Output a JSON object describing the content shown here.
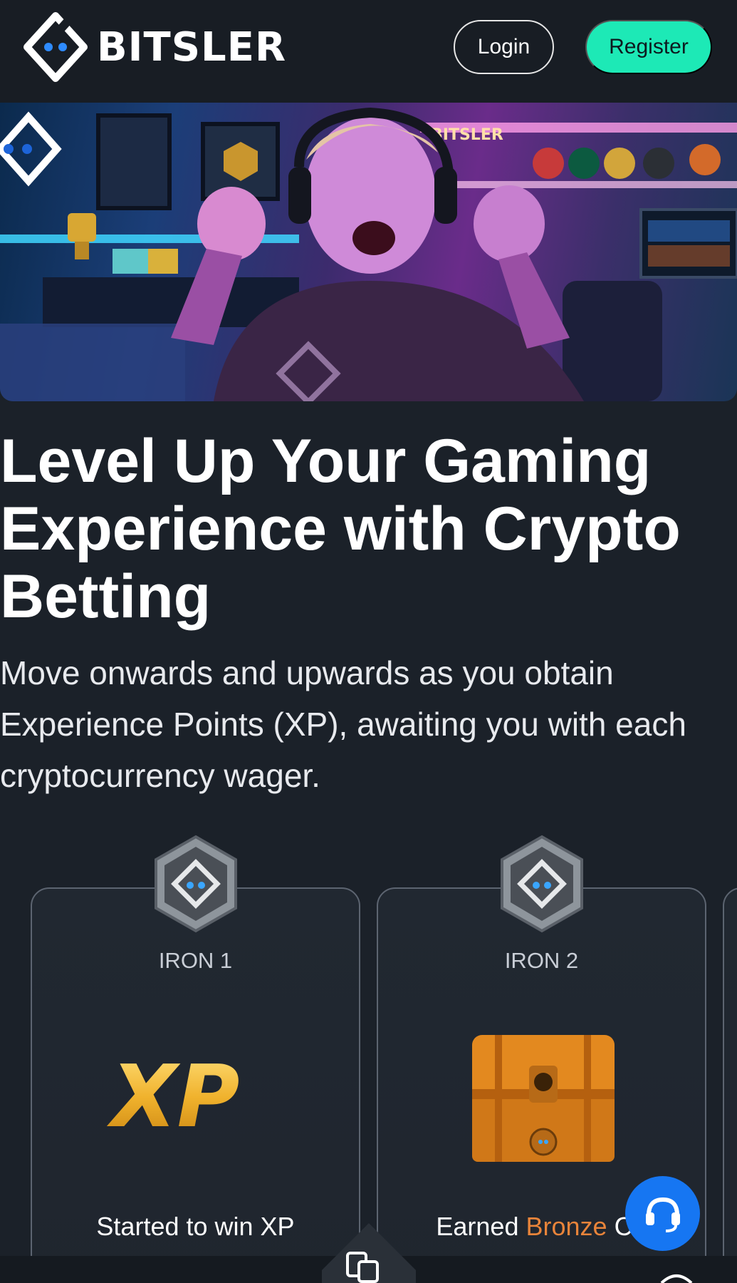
{
  "brand": {
    "name": "BITSLER"
  },
  "header": {
    "login_label": "Login",
    "register_label": "Register"
  },
  "hero": {
    "sign_text": "BITSLER"
  },
  "headline": "Level Up Your Gaming Experience with Crypto Betting",
  "subtext": "Move onwards and upwards as you obtain Experience Points (XP), awaiting you with each cryptocurrency wager.",
  "levels": [
    {
      "label": "IRON 1",
      "reward_text": "Started to win XP",
      "art": "XP"
    },
    {
      "label": "IRON 2",
      "reward_prefix": "Earned ",
      "reward_highlight": "Bronze",
      "reward_suffix": " Ch"
    }
  ],
  "colors": {
    "background": "#1b2129",
    "accent": "#1de9b6",
    "bronze": "#e8843a",
    "chat": "#1676f2"
  },
  "icons": [
    "bitsler-logo-icon",
    "iron-badge-icon",
    "treasure-chest-icon",
    "support-headset-icon",
    "games-icon"
  ]
}
